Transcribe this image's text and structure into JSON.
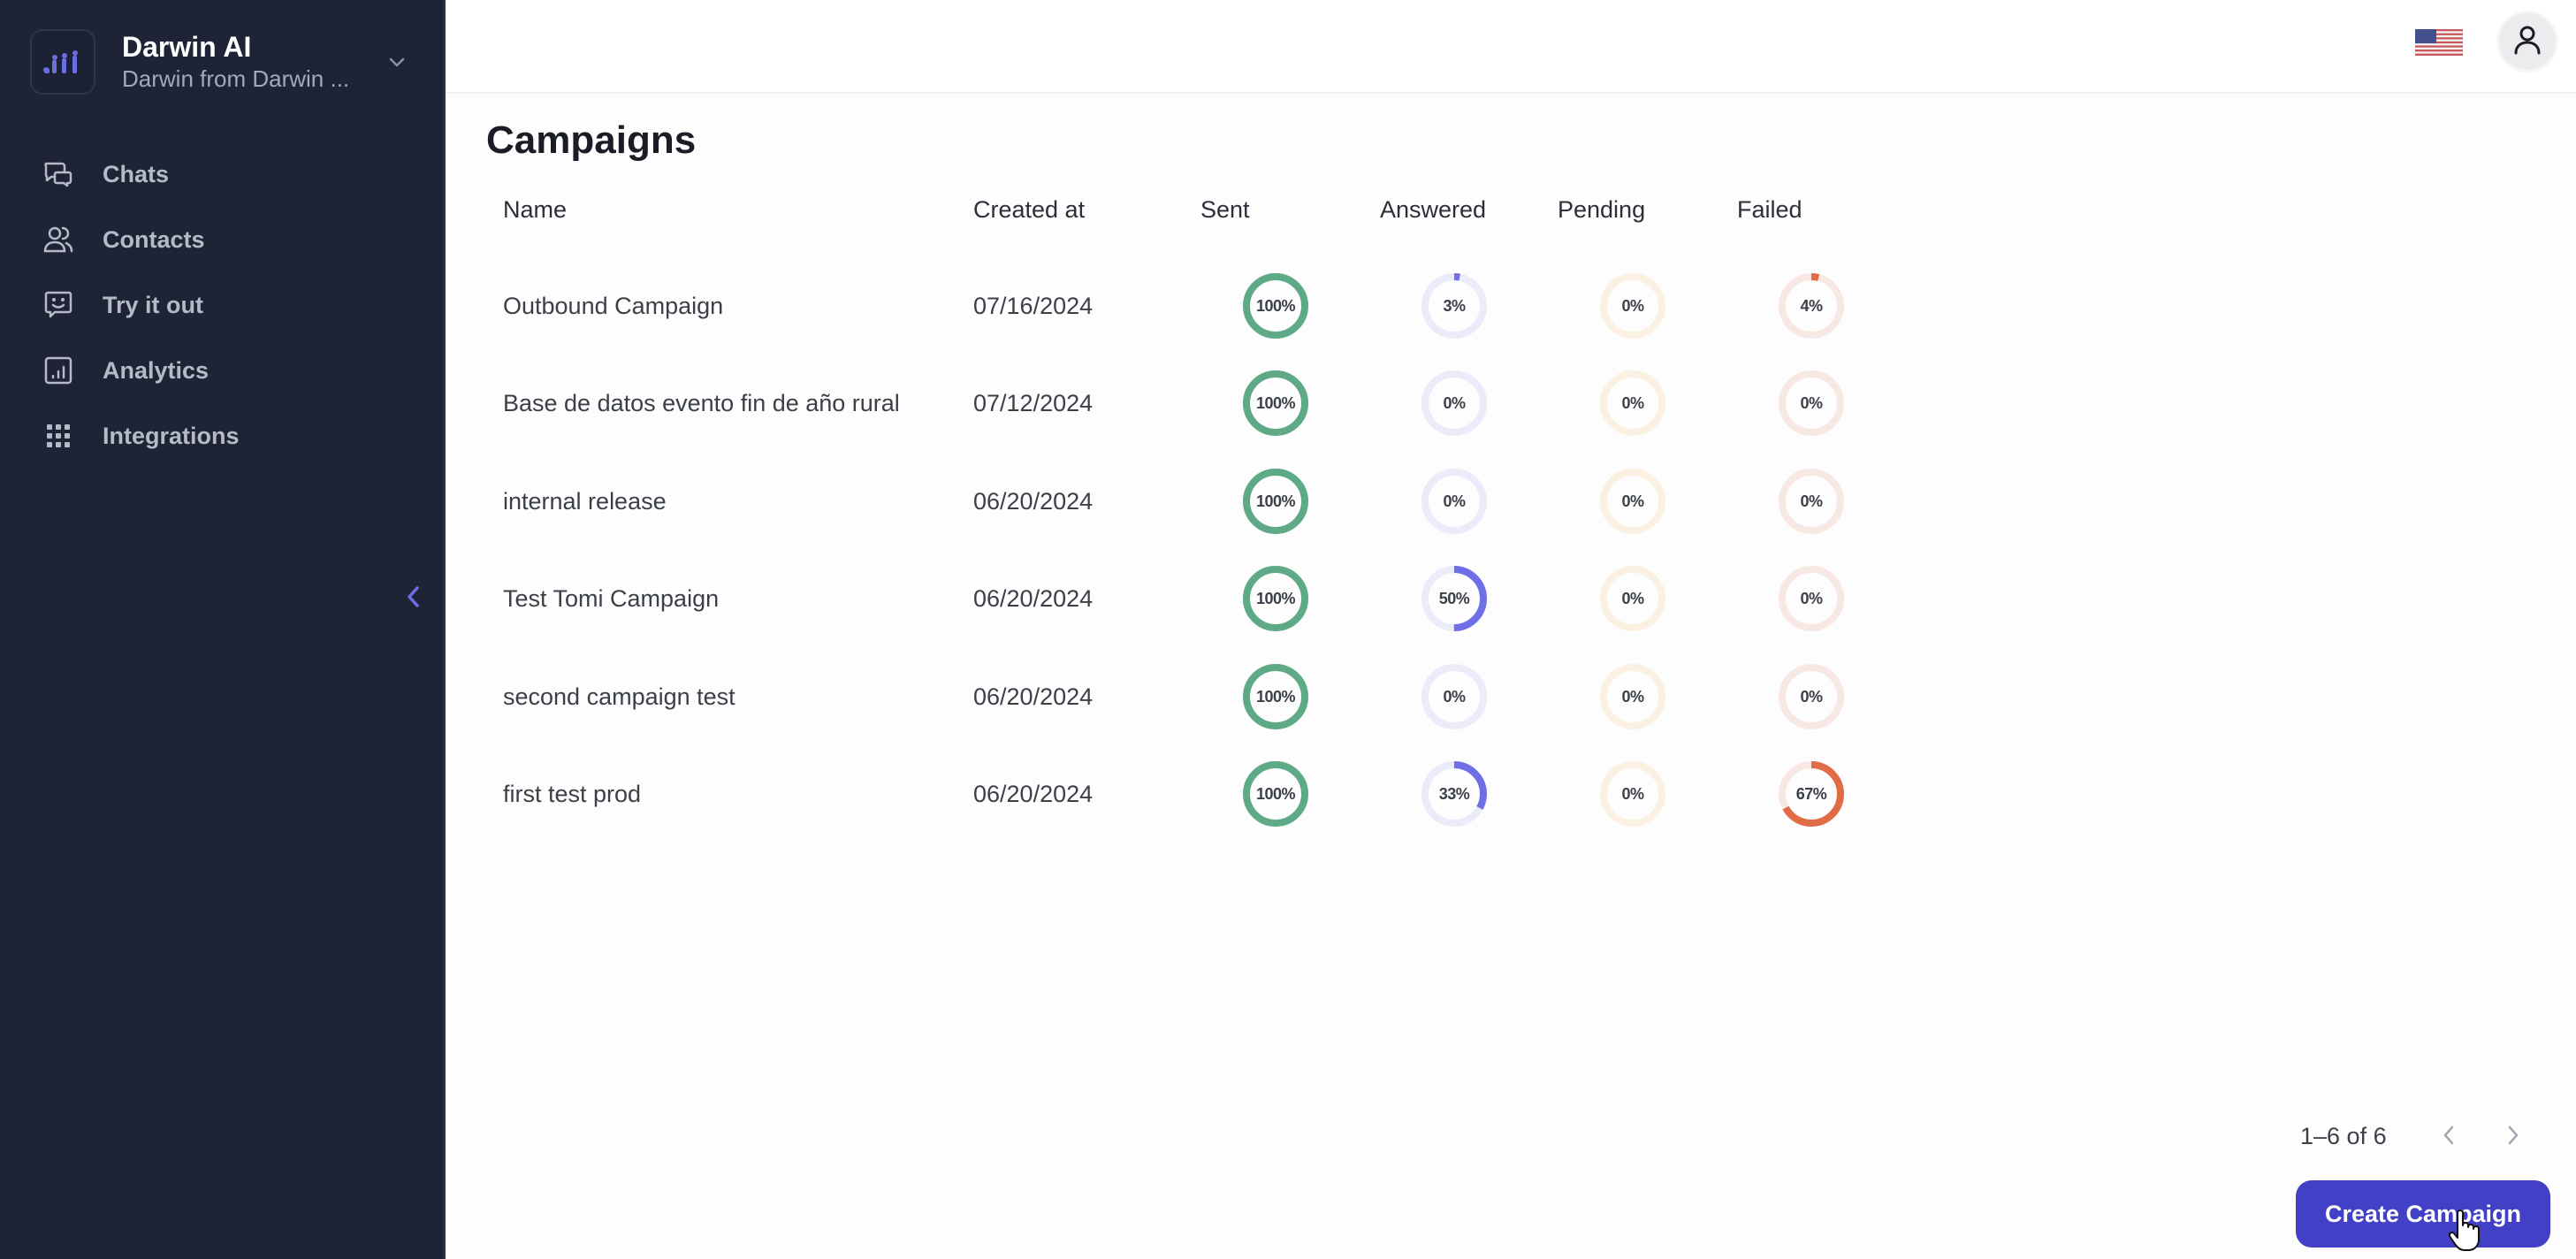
{
  "sidebar": {
    "org_name": "Darwin AI",
    "org_subtitle": "Darwin from Darwin ...",
    "items": [
      {
        "label": "Chats",
        "icon": "chats-icon"
      },
      {
        "label": "Contacts",
        "icon": "contacts-icon"
      },
      {
        "label": "Try it out",
        "icon": "smiley-chat-icon"
      },
      {
        "label": "Analytics",
        "icon": "analytics-icon"
      },
      {
        "label": "Integrations",
        "icon": "grid-icon"
      }
    ]
  },
  "header": {
    "language_flag": "us-flag-icon",
    "user_icon": "user-icon"
  },
  "page": {
    "title": "Campaigns"
  },
  "colors": {
    "sent": "#5faa86",
    "sent_track": "#d9eee4",
    "answered": "#6e6ee6",
    "answered_track": "#ebebfa",
    "pending": "#f0c46a",
    "pending_track": "#fbf1e2",
    "failed": "#e06b45",
    "failed_track": "#f8e8e3",
    "accent": "#4240c6",
    "sidebar_bg": "#1e2336"
  },
  "table": {
    "columns": [
      "Name",
      "Created at",
      "Sent",
      "Answered",
      "Pending",
      "Failed"
    ],
    "rows": [
      {
        "name": "Outbound Campaign",
        "created_at": "07/16/2024",
        "sent": 100,
        "answered": 3,
        "pending": 0,
        "failed": 4
      },
      {
        "name": "Base de datos evento fin de año rural",
        "created_at": "07/12/2024",
        "sent": 100,
        "answered": 0,
        "pending": 0,
        "failed": 0
      },
      {
        "name": "internal release",
        "created_at": "06/20/2024",
        "sent": 100,
        "answered": 0,
        "pending": 0,
        "failed": 0
      },
      {
        "name": "Test Tomi Campaign",
        "created_at": "06/20/2024",
        "sent": 100,
        "answered": 50,
        "pending": 0,
        "failed": 0
      },
      {
        "name": "second campaign test",
        "created_at": "06/20/2024",
        "sent": 100,
        "answered": 0,
        "pending": 0,
        "failed": 0
      },
      {
        "name": "first test prod",
        "created_at": "06/20/2024",
        "sent": 100,
        "answered": 33,
        "pending": 0,
        "failed": 67
      }
    ]
  },
  "pagination": {
    "range_label": "1–6 of 6"
  },
  "actions": {
    "create_label": "Create Campaign"
  }
}
